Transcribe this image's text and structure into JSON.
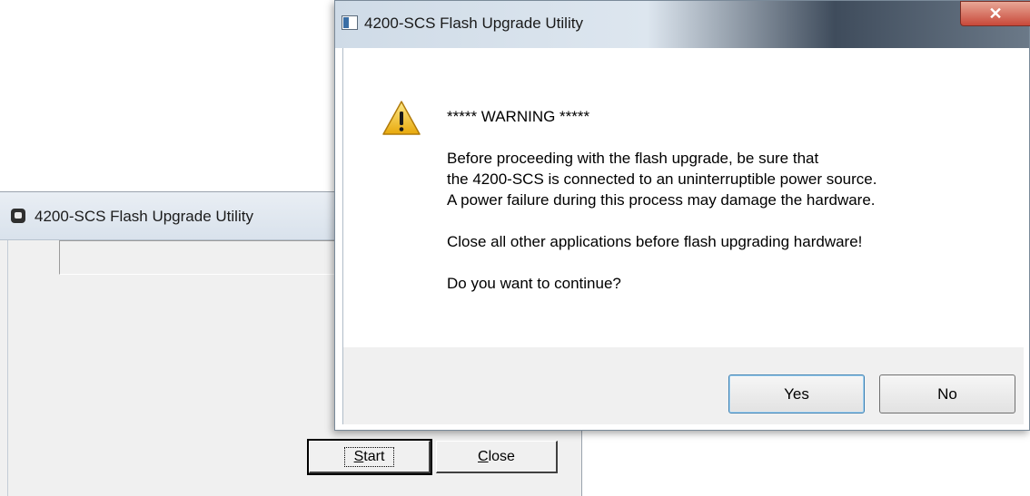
{
  "main_window": {
    "title": "4200-SCS Flash Upgrade Utility",
    "progress": 0,
    "start_button": {
      "mnemonic": "S",
      "rest": "tart"
    },
    "close_button": {
      "mnemonic": "C",
      "rest": "lose"
    }
  },
  "dialog": {
    "title": "4200-SCS Flash Upgrade Utility",
    "close_glyph": "✕",
    "icon": "warning-icon",
    "lines": [
      "***** WARNING *****",
      "Before proceeding with the flash upgrade, be sure that",
      "the 4200-SCS is connected to an uninterruptible power source.",
      "A power failure during this process may damage the hardware.",
      "Close all other applications before flash upgrading hardware!",
      "Do you want to continue?"
    ],
    "yes_label": "Yes",
    "no_label": "No"
  },
  "colors": {
    "warning_yellow": "#f5c518",
    "close_red": "#c8493a",
    "window_face": "#f0f0f0"
  }
}
